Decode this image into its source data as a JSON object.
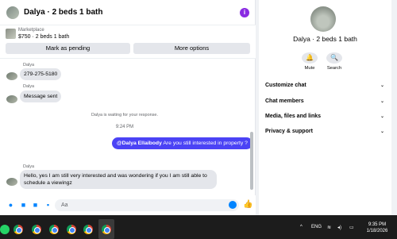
{
  "chat": {
    "title": "Dalya · 2 beds 1 bath",
    "listing": {
      "source": "Marketplace",
      "price": "$750 · 2 beds 1 bath"
    },
    "buttons": {
      "pending": "Mark as pending",
      "more": "More options"
    },
    "messages": [
      {
        "sender": "Dalya",
        "text": "279-275-5180"
      },
      {
        "sender": "Dalya",
        "text": "Message sent"
      }
    ],
    "waiting_note": "Dalya is waiting for your response.",
    "time": "9:24 PM",
    "outgoing": {
      "mention": "@Dalya Ellaibody",
      "text": " Are you still interested in property ?"
    },
    "last": {
      "sender": "Dalya",
      "text": "Hello, yes I am still very interested and was wondering if you I am still able to schedule a viewingz"
    },
    "composer": {
      "placeholder": "Aa"
    },
    "colors": {
      "outgoing": "#4b43f5",
      "accent": "#0084ff",
      "info": "#8a2be2"
    }
  },
  "info": {
    "name": "Dalya · 2 beds 1 bath",
    "actions": {
      "mute": "Mute",
      "search": "Search"
    },
    "sections": [
      "Customize chat",
      "Chat members",
      "Media, files and links",
      "Privacy & support"
    ]
  },
  "taskbar": {
    "lang": "ENG",
    "time": "9:35 PM",
    "date": "1/18/2026"
  }
}
